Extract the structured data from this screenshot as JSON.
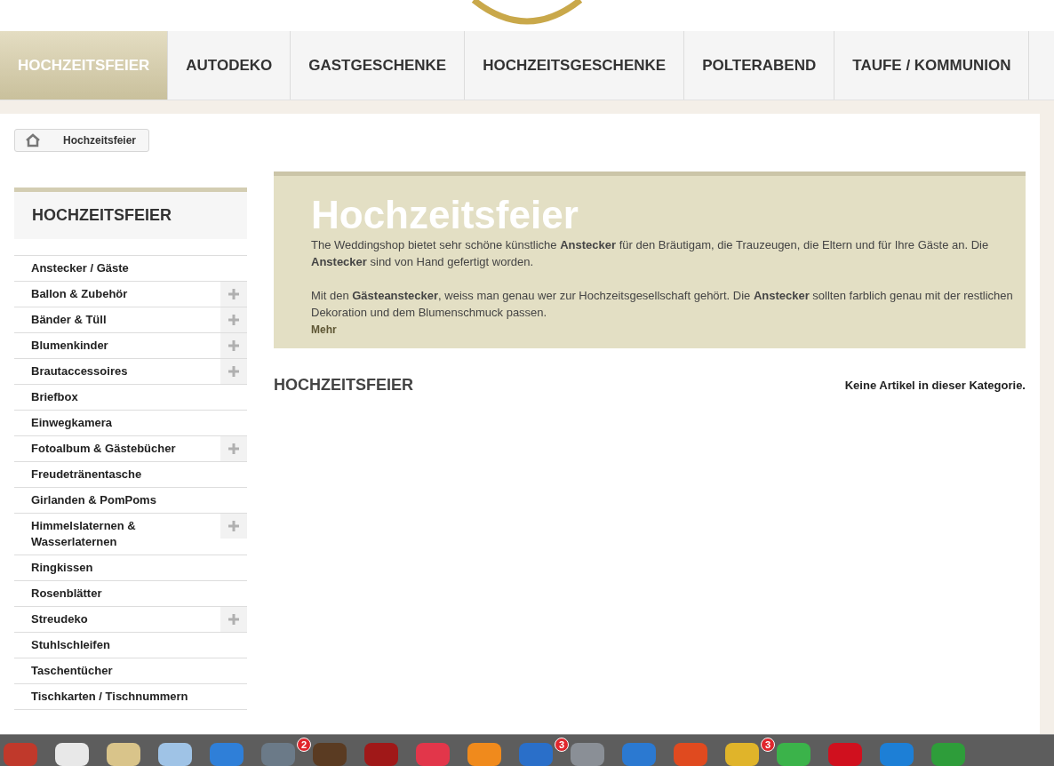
{
  "nav": [
    {
      "label": "HOCHZEITSFEIER",
      "selected": true
    },
    {
      "label": "AUTODEKO",
      "selected": false
    },
    {
      "label": "GASTGESCHENKE",
      "selected": false
    },
    {
      "label": "HOCHZEITSGESCHENKE",
      "selected": false
    },
    {
      "label": "POLTERABEND",
      "selected": false
    },
    {
      "label": "TAUFE / KOMMUNION",
      "selected": false
    }
  ],
  "breadcrumb": {
    "current": "Hochzeitsfeier"
  },
  "sidebar": {
    "title": "HOCHZEITSFEIER",
    "items": [
      {
        "label": "Anstecker / Gäste",
        "expandable": false
      },
      {
        "label": "Ballon & Zubehör",
        "expandable": true
      },
      {
        "label": "Bänder & Tüll",
        "expandable": true
      },
      {
        "label": "Blumenkinder",
        "expandable": true
      },
      {
        "label": "Brautaccessoires",
        "expandable": true
      },
      {
        "label": "Briefbox",
        "expandable": false
      },
      {
        "label": "Einwegkamera",
        "expandable": false
      },
      {
        "label": "Fotoalbum & Gästebücher",
        "expandable": true
      },
      {
        "label": "Freudetränentasche",
        "expandable": false
      },
      {
        "label": "Girlanden & PomPoms",
        "expandable": false
      },
      {
        "label": "Himmelslaternen & Wasserlaternen",
        "expandable": true
      },
      {
        "label": "Ringkissen",
        "expandable": false
      },
      {
        "label": "Rosenblätter",
        "expandable": false
      },
      {
        "label": "Streudeko",
        "expandable": true
      },
      {
        "label": "Stuhlschleifen",
        "expandable": false
      },
      {
        "label": "Taschentücher",
        "expandable": false
      },
      {
        "label": "Tischkarten / Tischnummern",
        "expandable": false
      }
    ]
  },
  "banner": {
    "title": "Hochzeitsfeier",
    "paragraphs": [
      "The Weddingshop bietet sehr schöne künstliche **Anstecker** für den Bräutigam, die Trauzeugen, die Eltern und für Ihre Gäste an. Die **Anstecker** sind von Hand gefertigt worden.",
      "Mit den **Gästeanstecker**, weiss man genau wer zur Hochzeitsgesellschaft gehört. Die **Anstecker** sollten farblich genau mit der restlichen Dekoration und dem Blumenschmuck passen."
    ],
    "more": "Mehr"
  },
  "category": {
    "heading": "HOCHZEITSFEIER",
    "message": "Keine Artikel in dieser Kategorie."
  },
  "dock": [
    {
      "color": "#c0392b"
    },
    {
      "color": "#e8e8e8"
    },
    {
      "color": "#d9c48a"
    },
    {
      "color": "#9fc3e6"
    },
    {
      "color": "#2f7fd8"
    },
    {
      "color": "#6b7a88",
      "badge": "2"
    },
    {
      "color": "#5a3b22"
    },
    {
      "color": "#a01818"
    },
    {
      "color": "#e2364a"
    },
    {
      "color": "#f08a1c"
    },
    {
      "color": "#2a6fc9",
      "badge": "3"
    },
    {
      "color": "#8a8f96"
    },
    {
      "color": "#2b79d1"
    },
    {
      "color": "#e04a1f"
    },
    {
      "color": "#e0b42a",
      "badge": "3"
    },
    {
      "color": "#3bb34a"
    },
    {
      "color": "#d0101e"
    },
    {
      "color": "#1d7fd6"
    },
    {
      "color": "#2e9d3a"
    }
  ]
}
